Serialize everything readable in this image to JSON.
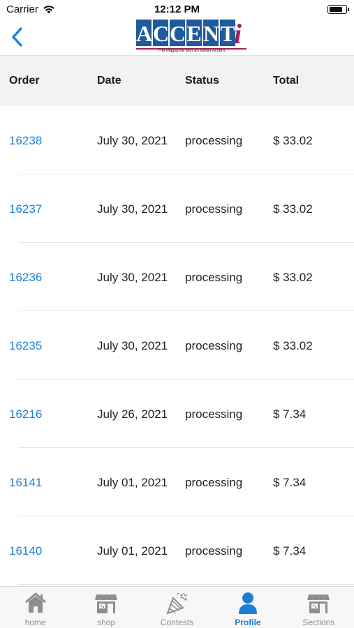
{
  "status_bar": {
    "carrier": "Carrier",
    "time": "12:12 PM",
    "battery_level": 0.85
  },
  "nav": {
    "back_icon": "chevron-left-icon",
    "logo_text": "ACCENT",
    "logo_letters": [
      "A",
      "C",
      "C",
      "E",
      "N",
      "T"
    ],
    "logo_i": "i",
    "logo_tagline": "The Magazine with an Italian Accent",
    "accent_color": "#1d7ed6",
    "brand_blue": "#1e5a9c",
    "brand_magenta": "#a41f5c"
  },
  "table": {
    "headers": {
      "order": "Order",
      "date": "Date",
      "status": "Status",
      "total": "Total"
    },
    "rows": [
      {
        "order": "16238",
        "date": "July 30, 2021",
        "status": "processing",
        "total": "$ 33.02"
      },
      {
        "order": "16237",
        "date": "July 30, 2021",
        "status": "processing",
        "total": "$ 33.02"
      },
      {
        "order": "16236",
        "date": "July 30, 2021",
        "status": "processing",
        "total": "$ 33.02"
      },
      {
        "order": "16235",
        "date": "July 30, 2021",
        "status": "processing",
        "total": "$ 33.02"
      },
      {
        "order": "16216",
        "date": "July 26, 2021",
        "status": "processing",
        "total": "$ 7.34"
      },
      {
        "order": "16141",
        "date": "July 01, 2021",
        "status": "processing",
        "total": "$ 7.34"
      },
      {
        "order": "16140",
        "date": "July 01, 2021",
        "status": "processing",
        "total": "$ 7.34"
      }
    ]
  },
  "tabs": [
    {
      "label": "home",
      "icon": "home-icon",
      "active": false
    },
    {
      "label": "shop",
      "icon": "store-icon",
      "active": false
    },
    {
      "label": "Contests",
      "icon": "party-popper-icon",
      "active": false
    },
    {
      "label": "Profile",
      "icon": "person-icon",
      "active": true
    },
    {
      "label": "Sections",
      "icon": "store-icon",
      "active": false
    }
  ]
}
